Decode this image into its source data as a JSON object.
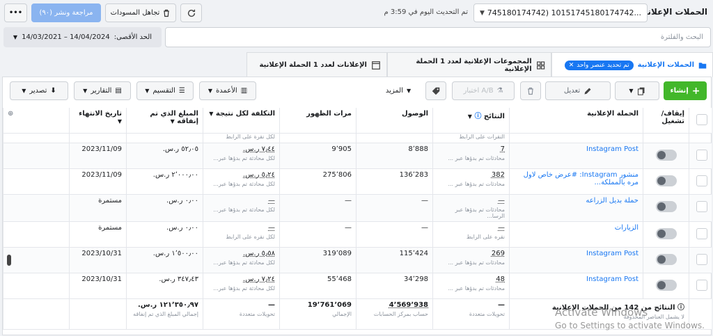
{
  "header": {
    "title": "الحملات الإعلانية",
    "campaign_select": "745180174742) 10151745180174742...",
    "updated": "تم التحديث اليوم في 3:59 م",
    "discard_drafts": "تجاهل المسودات",
    "review_publish": "مراجعة ونشر (٩٠)",
    "more": "•••"
  },
  "search": {
    "placeholder": "البحث والفلترة",
    "date_label": "الحد الأقصى:",
    "date_value": "14/03/2021 – 14/04/2024"
  },
  "tabs": [
    {
      "label": "الحملات الإعلانية",
      "chip": "تم تحديد عنصر واحد"
    },
    {
      "label": "المجموعات الإعلانية لعدد 1 الحملة الإعلانية"
    },
    {
      "label": "الإعلانات لعدد 1 الحملة الإعلانية"
    }
  ],
  "toolbar": {
    "create": "إنشاء",
    "edit": "تعديل",
    "ab_test": "اختبار A/B",
    "more": "المزيد",
    "columns": "الأعمدة",
    "breakdown": "التقسيم",
    "reports": "التقارير",
    "export": "تصدير"
  },
  "columns": {
    "toggle": "إيقاف/تشغيل",
    "campaign": "الحملة الإعلانية",
    "results": "النتائج",
    "reach": "الوصول",
    "impressions": "مرات الظهور",
    "cost_per_result": "التكلفة لكل نتيجة",
    "amount_spent": "المبلغ الذي تم إنفاقه",
    "end_date": "تاريخ الانتهاء"
  },
  "top_partial": {
    "results_sub": "النقرات على الرابط",
    "cost_sub": "لكل نقرة على الرابط"
  },
  "rows": [
    {
      "name": "Instagram Post",
      "results": "7",
      "results_sub": "محادثات تم بدؤها عبر ...",
      "reach": "8٬888",
      "impressions": "9٬905",
      "cost": "٧٫٤٤ ر.س.",
      "cost_sub": "لكل محادثة تم بدؤها عبر...",
      "spent": "٥٢٫٠٥ ر.س.",
      "end": "2023/11/09"
    },
    {
      "name": "منشور Instagram: #عرض خاص لاول مره بالمملكة...",
      "results": "382",
      "results_sub": "محادثات تم بدؤها عبر ...",
      "reach": "136٬283",
      "impressions": "275٬806",
      "cost": "٥٫٢٤ ر.س.",
      "cost_sub": "لكل محادثة تم بدؤها عبر...",
      "spent": "٢٬٠٠٠٫٠٠ ر.س.",
      "end": "2023/11/09"
    },
    {
      "name": "حملة بديل الزراعه",
      "results": "—",
      "results_sub": "محادثات تم بدؤها عبر الرسا...",
      "reach": "—",
      "impressions": "—",
      "cost": "—",
      "cost_sub": "لكل محادثة تم بدؤها عبر...",
      "spent": "٠٫٠٠ ر.س.",
      "end": "مستمرة"
    },
    {
      "name": "الزيارات",
      "results": "—",
      "results_sub": "نقره على الرابط",
      "reach": "—",
      "impressions": "—",
      "cost": "—",
      "cost_sub": "لكل نقره على الرابط",
      "spent": "٠٫٠٠ ر.س.",
      "end": "مستمرة"
    },
    {
      "name": "Instagram Post",
      "results": "269",
      "results_sub": "محادثات تم بدؤها عبر ...",
      "reach": "115٬424",
      "impressions": "319٬089",
      "cost": "٥٫٥٨ ر.س.",
      "cost_sub": "لكل محادثة تم بدؤها عبر...",
      "spent": "١٬٥٠٠٫٠٠ ر.س.",
      "end": "2023/10/31"
    },
    {
      "name": "Instagram Post",
      "results": "48",
      "results_sub": "محادثات تم بدؤها عبر ...",
      "reach": "34٬298",
      "impressions": "55٬468",
      "cost": "٧٫٢٤ ر.س.",
      "cost_sub": "لكل محادثة تم بدؤها عبر...",
      "spent": "٣٤٧٫٤٣ ر.س.",
      "end": "2023/10/31"
    }
  ],
  "totals": {
    "label": "النتائج من 142 من الحملات الإعلانية",
    "label_sub": "لا يشمل العناصر المحذوفة",
    "results": "—",
    "results_sub": "تحويلات متعددة",
    "reach": "4٬569٬938",
    "reach_sub": "حساب بمركز الحسابات",
    "impressions": "19٬761٬069",
    "impressions_sub": "الإجمالي",
    "cost": "—",
    "cost_sub": "تحويلات متعددة",
    "spent": "١٢١٬٣٥٠٫٩٧ ر.س.",
    "spent_sub": "إجمالي المبلغ الذي تم إنفاقه"
  },
  "watermark": {
    "line1": "Activate Windows",
    "line2": "Go to Settings to activate Windows."
  }
}
